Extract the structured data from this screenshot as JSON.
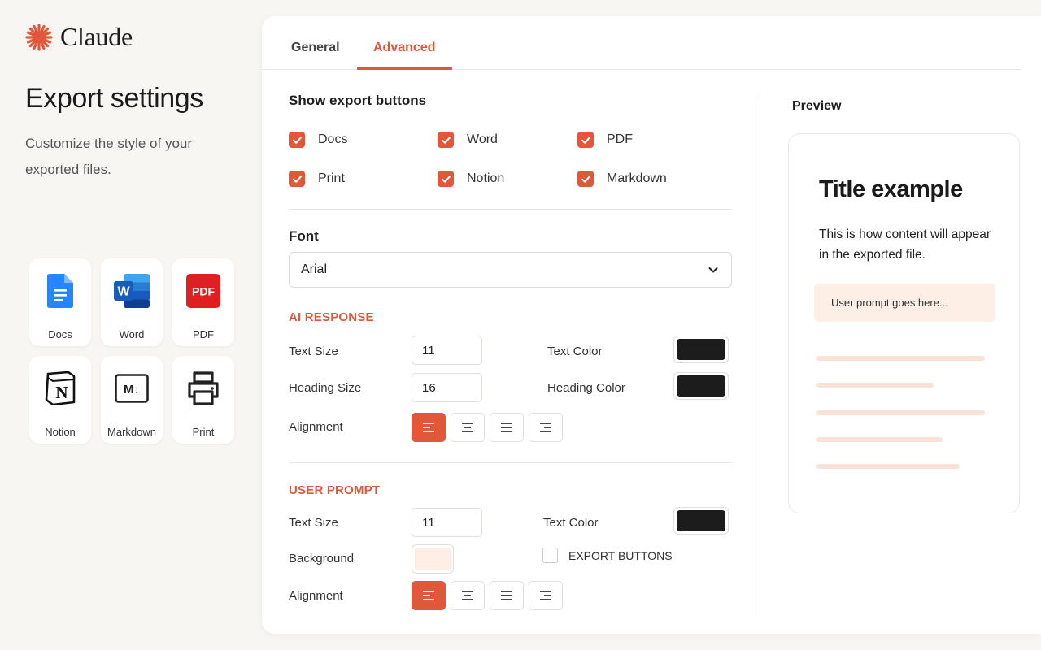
{
  "brand": {
    "name": "Claude",
    "accent": "#e0573a"
  },
  "left": {
    "title": "Export settings",
    "subtitle": "Customize the style of your exported files.",
    "apps": [
      {
        "label": "Docs",
        "icon": "google-docs-icon"
      },
      {
        "label": "Word",
        "icon": "word-icon"
      },
      {
        "label": "PDF",
        "icon": "pdf-icon",
        "badge": "PDF"
      },
      {
        "label": "Notion",
        "icon": "notion-icon",
        "badge": "N"
      },
      {
        "label": "Markdown",
        "icon": "markdown-icon",
        "badge": "M↓"
      },
      {
        "label": "Print",
        "icon": "printer-icon"
      }
    ]
  },
  "tabs": [
    {
      "label": "General",
      "active": false
    },
    {
      "label": "Advanced",
      "active": true
    }
  ],
  "export_buttons": {
    "heading": "Show export buttons",
    "options": [
      {
        "label": "Docs",
        "checked": true
      },
      {
        "label": "Word",
        "checked": true
      },
      {
        "label": "PDF",
        "checked": true
      },
      {
        "label": "Print",
        "checked": true
      },
      {
        "label": "Notion",
        "checked": true
      },
      {
        "label": "Markdown",
        "checked": true
      }
    ]
  },
  "font": {
    "heading": "Font",
    "selected": "Arial"
  },
  "ai_response": {
    "heading": "AI RESPONSE",
    "text_size_label": "Text Size",
    "text_size": "11",
    "heading_size_label": "Heading Size",
    "heading_size": "16",
    "text_color_label": "Text Color",
    "text_color": "#1c1c1c",
    "heading_color_label": "Heading Color",
    "heading_color": "#1c1c1c",
    "alignment_label": "Alignment",
    "alignment": "left"
  },
  "user_prompt": {
    "heading": "USER PROMPT",
    "text_size_label": "Text Size",
    "text_size": "11",
    "text_color_label": "Text Color",
    "text_color": "#1c1c1c",
    "background_label": "Background",
    "background_color": "#fdeee6",
    "export_buttons_label": "EXPORT BUTTONS",
    "export_buttons_checked": false,
    "alignment_label": "Alignment",
    "alignment": "left"
  },
  "preview": {
    "label": "Preview",
    "title": "Title example",
    "body": "This is how content will appear in the exported file.",
    "prompt": "User prompt goes here..."
  }
}
